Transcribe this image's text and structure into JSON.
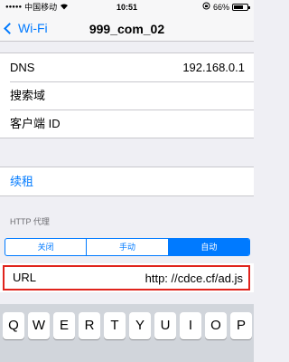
{
  "status": {
    "carrier": "中国移动",
    "time": "10:51",
    "battery_pct": "66%",
    "battery_level": 0.66
  },
  "nav": {
    "back_label": "Wi-Fi",
    "title": "999_com_02"
  },
  "info_rows": [
    {
      "label": "DNS",
      "value": "192.168.0.1"
    },
    {
      "label": "搜索域",
      "value": ""
    },
    {
      "label": "客户端 ID",
      "value": ""
    }
  ],
  "renew_label": "续租",
  "http_proxy": {
    "header": "HTTP 代理",
    "options": [
      "关闭",
      "手动",
      "自动"
    ],
    "selected": "自动"
  },
  "url_field": {
    "label": "URL",
    "value": "http: //cdce.cf/ad.js"
  },
  "keyboard": {
    "row1": [
      "Q",
      "W",
      "E",
      "R",
      "T",
      "Y",
      "U",
      "I",
      "O",
      "P"
    ]
  },
  "colors": {
    "accent": "#007aff",
    "highlight": "#e0231c",
    "background": "#efeff4"
  }
}
